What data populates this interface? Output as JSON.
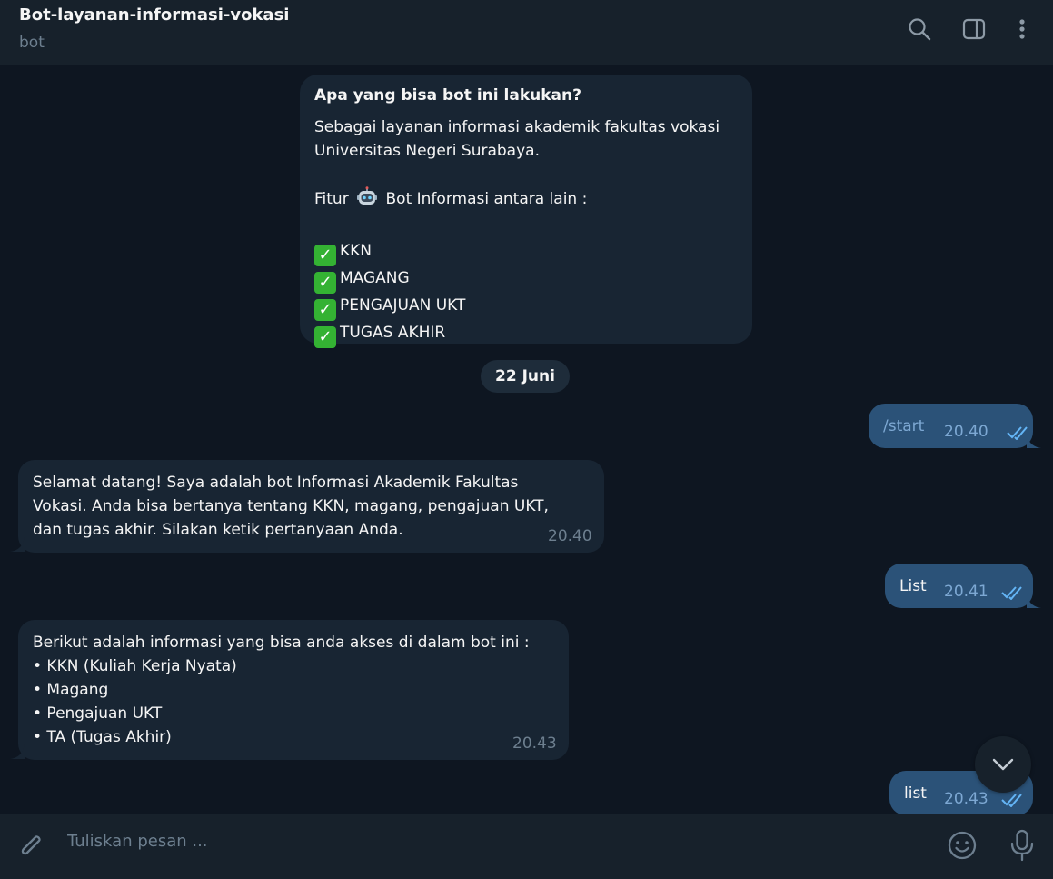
{
  "header": {
    "title": "Bot-layanan-informasi-vokasi",
    "subtitle": "bot"
  },
  "info_card": {
    "title": "Apa yang bisa bot ini lakukan?",
    "line1": "Sebagai layanan informasi akademik fakultas vokasi",
    "line2": "Universitas Negeri Surabaya.",
    "feature_prefix": "Fitur",
    "feature_suffix": "Bot Informasi antara lain :",
    "features": [
      "KKN",
      "MAGANG",
      "PENGAJUAN UKT",
      "TUGAS AKHIR"
    ]
  },
  "date_separator": "22 Juni",
  "messages": [
    {
      "text": "/start",
      "time": "20.40"
    },
    {
      "lines": [
        "Selamat datang! Saya adalah bot Informasi Akademik Fakultas",
        "Vokasi. Anda bisa bertanya tentang KKN, magang, pengajuan UKT,",
        "dan tugas akhir. Silakan ketik pertanyaan Anda."
      ],
      "time": "20.40"
    },
    {
      "text": "List",
      "time": "20.41"
    },
    {
      "lines": [
        "Berikut adalah informasi yang bisa anda akses di dalam bot ini :",
        "• KKN (Kuliah Kerja Nyata)",
        "• Magang",
        "• Pengajuan UKT",
        "• TA (Tugas Akhir)"
      ],
      "time": "20.43"
    },
    {
      "text": "list",
      "time": "20.43"
    }
  ],
  "composer": {
    "placeholder": "Tuliskan pesan ..."
  },
  "colors": {
    "background": "#0e1621",
    "header": "#17212b",
    "incoming_bubble": "#182533",
    "outgoing_bubble": "#2b5278",
    "read_ticks": "#64b5f6"
  },
  "icons": [
    "search-icon",
    "sidebar-toggle-icon",
    "more-vertical-icon",
    "paperclip-icon",
    "emoji-icon",
    "microphone-icon",
    "chevron-down-icon"
  ]
}
